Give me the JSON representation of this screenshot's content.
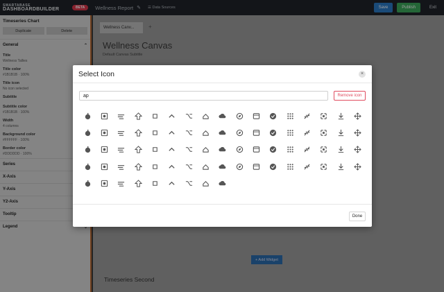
{
  "header": {
    "logo_line1": "SMARTABASE",
    "logo_line2": "DASHBOARDBUILDER",
    "badge": "BETA",
    "report_name": "Wellness Report",
    "data_sources": "Data Sources",
    "save": "Save",
    "publish": "Publish",
    "exit": "Exit"
  },
  "sidebar": {
    "title": "Timeseries Chart",
    "duplicate": "Duplicate",
    "delete": "Delete",
    "general": "General",
    "fields": [
      {
        "label": "Title",
        "value": "Wellness Tallies"
      },
      {
        "label": "Title color",
        "value": "#1B1B1B · 100%"
      },
      {
        "label": "Title icon",
        "value": "No icon selected"
      },
      {
        "label": "Subtitle",
        "value": ""
      },
      {
        "label": "Subtitle color",
        "value": "#1B1B1B · 100%"
      },
      {
        "label": "Width",
        "value": "4 columns"
      },
      {
        "label": "Background color",
        "value": "#FFFFFF · 100%"
      },
      {
        "label": "Border color",
        "value": "#DDDDDD · 100%"
      }
    ],
    "sections": [
      "Series",
      "X-Axis",
      "Y-Axis",
      "Y2-Axis",
      "Tooltip",
      "Legend"
    ]
  },
  "canvas": {
    "tab": "Wellness Canv...",
    "title": "Wellness Canvas",
    "subtitle": "Default Canvas Subtitle",
    "add_widget": "+ Add Widget",
    "footer_section": "Timeseries Second"
  },
  "modal": {
    "title": "Select Icon",
    "search_value": "ap",
    "remove_icon": "Remove icon",
    "done": "Done",
    "icons": [
      "apple-icon",
      "app-settings-icon",
      "app-registration-icon",
      "arrow-upward-icon",
      "command-icon",
      "expand-less-icon",
      "keyboard-option-icon",
      "keyboard-arrow-up-icon",
      "cloud-icon",
      "explore-icon",
      "web-asset-icon",
      "verified-icon",
      "apps-icon",
      "fullscreen-exit-icon",
      "compress-icon",
      "download-icon",
      "open-with-icon",
      "first-page-icon",
      "last-page-icon",
      "vertical-align-top-icon",
      "unfold-less-icon",
      "bold-icon",
      "share-icon",
      "closed-caption-icon",
      "crop-square-icon",
      "sentiment-icon",
      "login-icon",
      "apple-fruit-icon",
      "product-p-icon",
      "format-align-top-icon",
      "image-aspect-icon",
      "image-landscape-icon",
      "vertical-align-center-icon",
      "touch-app-icon",
      "touch-icon",
      "tap-icon",
      "tap-and-play-icon",
      "tile-grid-icon",
      "brightness-icon",
      "local-convenience-icon",
      "text-fields-icon",
      "keyboard-capslock-icon",
      "laptop-icon",
      "laptop-chromebook-icon",
      "laptop-windows-icon",
      "desktop-access-disabled-icon",
      "laptop-mac-icon",
      "map-icon",
      "place-icon",
      "location-searching-icon",
      "place-add-icon",
      "explore-off-icon",
      "location-off-icon",
      "location-on-icon",
      "add-location-icon",
      "wrong-location-icon",
      "web-icon",
      "flip-to-back-icon",
      "app-blocking-icon",
      "card-giftcard-icon",
      "attach-file-icon",
      "library-add-icon",
      "bookmark-add-icon",
      "rotate-right-icon",
      "category-icon",
      "widgets-icon",
      "redo-icon",
      "open-in-new-icon",
      "add-to-queue-icon",
      "account-tree-icon",
      "stay-current-icon",
      "swap-horiz-icon",
      "swap-vert-icon",
      "tonality-icon",
      "bakery-icon",
      "whatsapp-icon",
      "playlist-add-icon"
    ]
  }
}
